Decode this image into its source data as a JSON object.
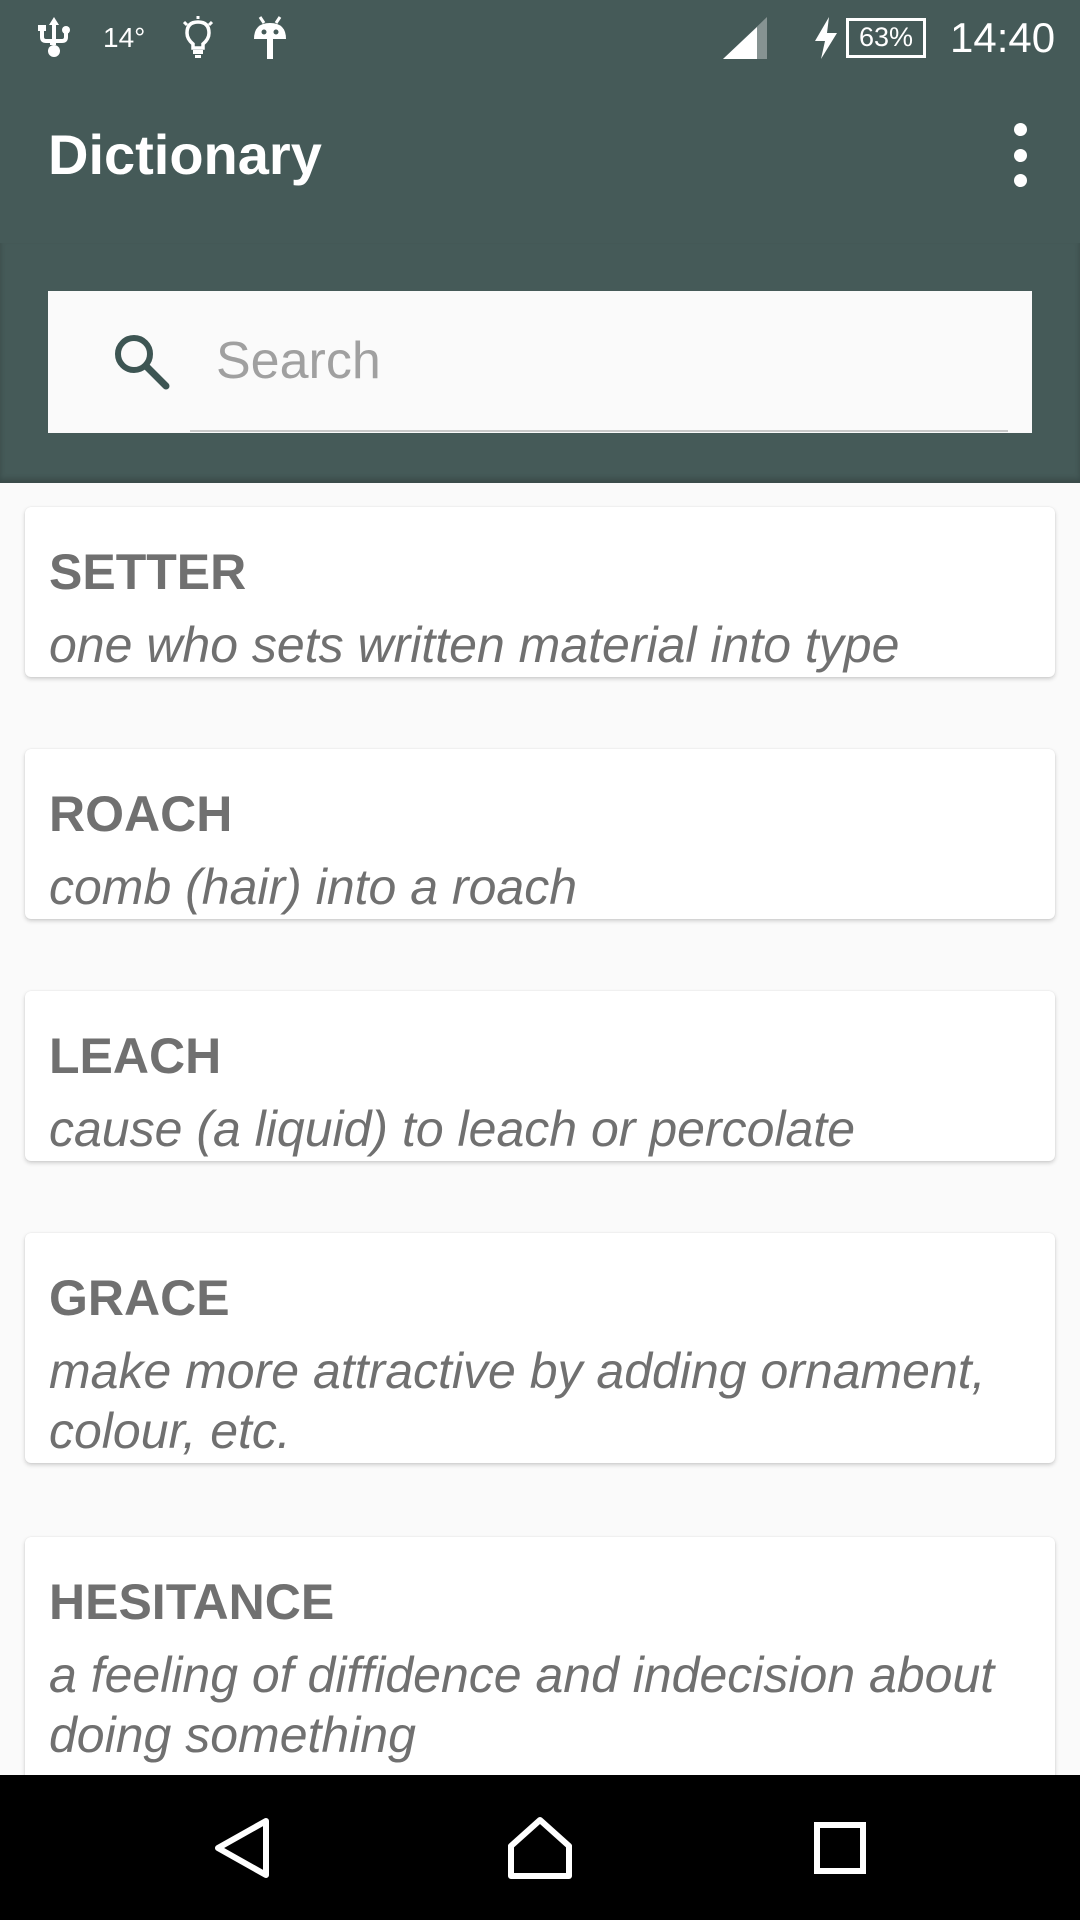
{
  "status_bar": {
    "temperature": "14°",
    "battery": "63%",
    "time": "14:40",
    "icons": [
      "usb-icon",
      "lightbulb-icon",
      "android-icon",
      "signal-icon",
      "charging-icon",
      "battery-icon"
    ]
  },
  "toolbar": {
    "title": "Dictionary",
    "menu_icon": "more-vert-icon"
  },
  "search": {
    "icon": "search-icon",
    "placeholder": "Search",
    "value": ""
  },
  "entries": [
    {
      "word": "SETTER",
      "definition": "one who sets written material into type"
    },
    {
      "word": "ROACH",
      "definition": "comb (hair) into a roach"
    },
    {
      "word": "LEACH",
      "definition": "cause (a liquid) to leach or percolate"
    },
    {
      "word": "GRACE",
      "definition": "make more attractive by adding ornament, colour, etc."
    },
    {
      "word": "HESITANCE",
      "definition": "a feeling of diffidence and indecision about doing something"
    }
  ],
  "nav_bar": {
    "icons": [
      "back-icon",
      "home-icon",
      "recents-icon"
    ]
  },
  "colors": {
    "primary": "#455a58",
    "card_text": "#707070",
    "background": "#fafafa"
  }
}
